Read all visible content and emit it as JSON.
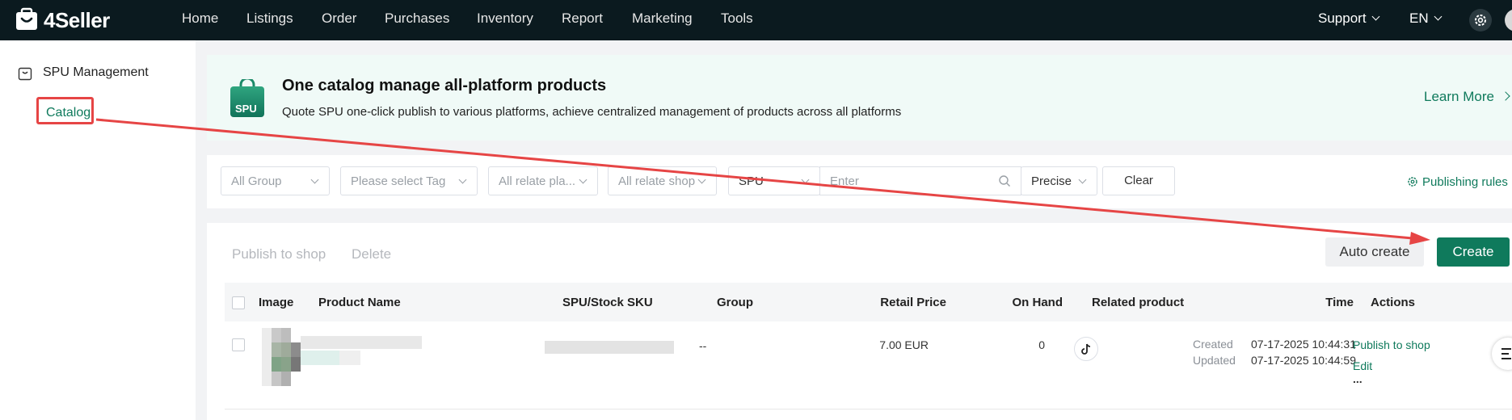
{
  "topbar": {
    "brand": "4Seller",
    "nav": [
      "Home",
      "Listings",
      "Order",
      "Purchases",
      "Inventory",
      "Report",
      "Marketing",
      "Tools"
    ],
    "support": "Support",
    "language": "EN"
  },
  "sidebar": {
    "section_title": "SPU Management",
    "item": "Catalog"
  },
  "banner": {
    "badge": "SPU",
    "title": "One catalog manage all-platform products",
    "subtitle": "Quote SPU one-click publish to various platforms, achieve centralized management of products across all platforms",
    "learn_more": "Learn More"
  },
  "filters": {
    "group": "All Group",
    "tag": "Please select Tag",
    "platform": "All relate pla...",
    "shop": "All relate shop",
    "search_type": "SPU",
    "search_placeholder": "Enter",
    "match": "Precise",
    "clear": "Clear",
    "publishing_rules": "Publishing rules"
  },
  "actions": {
    "publish_to_shop": "Publish to shop",
    "delete": "Delete",
    "auto_create": "Auto create",
    "create": "Create"
  },
  "table": {
    "columns": {
      "image": "Image",
      "product_name": "Product Name",
      "spu_sku": "SPU/Stock SKU",
      "group": "Group",
      "retail_price": "Retail Price",
      "on_hand": "On Hand",
      "related_product": "Related product",
      "time": "Time",
      "actions": "Actions"
    },
    "rows": [
      {
        "group": "--",
        "retail_price": "7.00 EUR",
        "on_hand": "0",
        "created_label": "Created",
        "created": "07-17-2025 10:44:31",
        "updated_label": "Updated",
        "updated": "07-17-2025 10:44:59",
        "action_publish": "Publish to shop",
        "action_edit": "Edit",
        "action_more": "..."
      }
    ]
  },
  "colors": {
    "brand_green": "#0f7a5c",
    "topbar": "#0b1a1f",
    "annotation_red": "#e64545"
  },
  "icons": [
    "logo-bag-icon",
    "chevron-down-icon",
    "gear-icon",
    "catalog-icon",
    "shopping-bag-icon",
    "chevron-right-icon",
    "search-icon",
    "tiktok-icon"
  ]
}
